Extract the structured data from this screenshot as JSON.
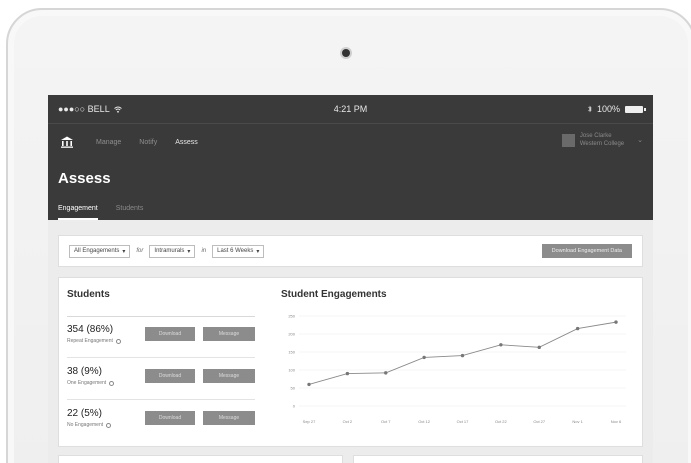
{
  "status_bar": {
    "carrier": "●●●○○ BELL",
    "time": "4:21 PM",
    "battery": "100%"
  },
  "nav": {
    "items": [
      {
        "label": "Manage",
        "active": false
      },
      {
        "label": "Notify",
        "active": false
      },
      {
        "label": "Assess",
        "active": true
      }
    ]
  },
  "user": {
    "name": "Jose Clarke",
    "org": "Western College"
  },
  "page": {
    "title": "Assess"
  },
  "tabs": [
    {
      "label": "Engagement",
      "active": true
    },
    {
      "label": "Students",
      "active": false
    }
  ],
  "filters": {
    "engagement": "All Engagements",
    "joiner_for": "for",
    "group": "Intramurals",
    "joiner_in": "in",
    "period": "Last 6 Weeks",
    "download_label": "Download Engagement Data"
  },
  "students": {
    "title": "Students",
    "rows": [
      {
        "value": "354 (86%)",
        "label": "Repeat Engagement"
      },
      {
        "value": "38 (9%)",
        "label": "One Engagement"
      },
      {
        "value": "22 (5%)",
        "label": "No Engagement"
      }
    ],
    "download_label": "Download",
    "message_label": "Message"
  },
  "chart_data": {
    "type": "line",
    "title": "Student Engagements",
    "categories": [
      "Sep 27",
      "Oct 2",
      "Oct 7",
      "Oct 12",
      "Oct 17",
      "Oct 22",
      "Oct 27",
      "Nov 1",
      "Nov 6"
    ],
    "values": [
      60,
      90,
      92,
      135,
      140,
      170,
      163,
      215,
      233
    ],
    "yticks": [
      "250",
      "200",
      "150",
      "100",
      "50",
      "0"
    ],
    "ylim": [
      0,
      250
    ],
    "grid": true,
    "color": "#8a8a8a"
  }
}
